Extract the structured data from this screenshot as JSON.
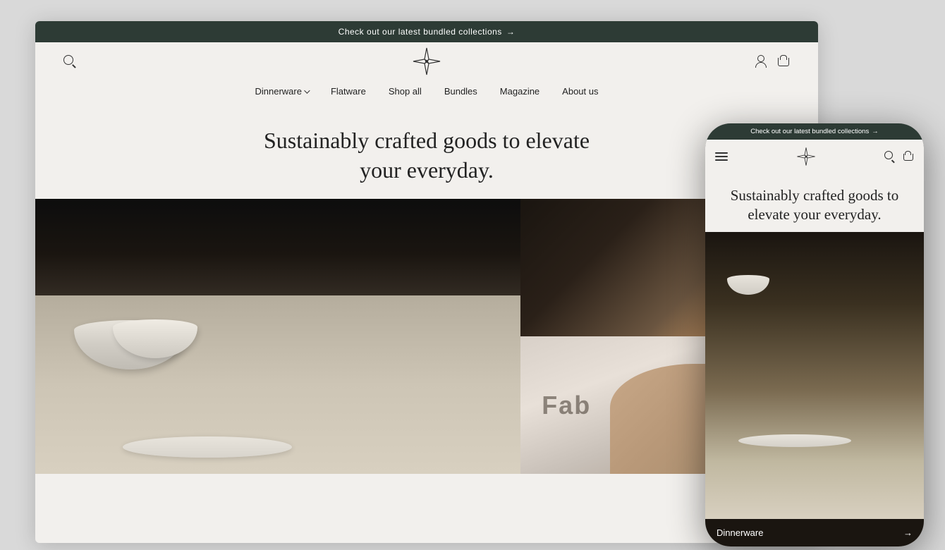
{
  "background_color": "#d0cec8",
  "desktop": {
    "announcement_bar": {
      "text": "Check out our latest bundled collections",
      "arrow": "→",
      "background": "#2d3b35"
    },
    "header": {
      "logo_alt": "Brand star logo"
    },
    "nav": {
      "items": [
        {
          "label": "Dinnerware",
          "has_dropdown": true
        },
        {
          "label": "Flatware",
          "has_dropdown": false
        },
        {
          "label": "Shop all",
          "has_dropdown": false
        },
        {
          "label": "Bundles",
          "has_dropdown": false
        },
        {
          "label": "Magazine",
          "has_dropdown": false
        },
        {
          "label": "About us",
          "has_dropdown": false
        }
      ]
    },
    "hero": {
      "headline_line1": "Sustainably crafted goods to elevate",
      "headline_line2": "your everyday."
    }
  },
  "phone": {
    "announcement_bar": {
      "text": "Check out our latest bundled collections",
      "arrow": "→"
    },
    "hero": {
      "headline": "Sustainably crafted goods to elevate your everyday."
    },
    "footer_bar": {
      "label": "Dinnerware",
      "arrow": "→"
    }
  }
}
